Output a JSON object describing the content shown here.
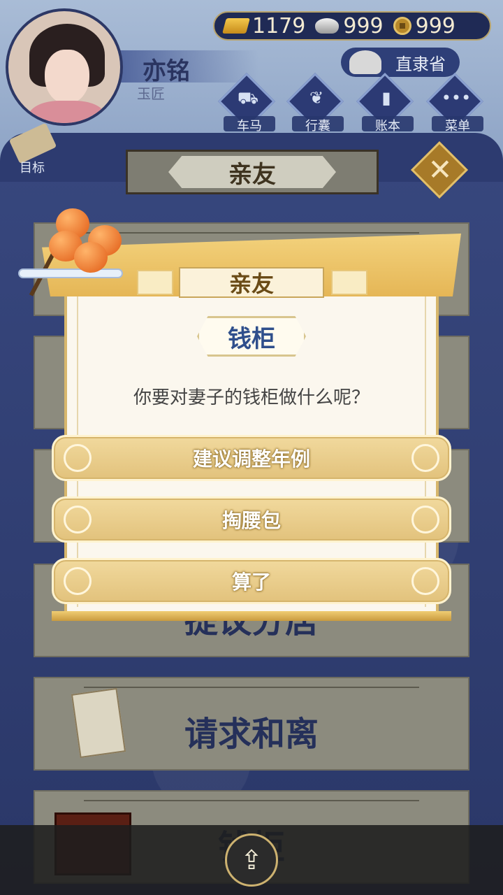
{
  "header": {
    "currencies": [
      {
        "icon": "gold-ingot-icon",
        "value": "1179"
      },
      {
        "icon": "silver-ingot-icon",
        "value": "999"
      },
      {
        "icon": "copper-coin-icon",
        "value": "999"
      }
    ],
    "player": {
      "name": "亦铭",
      "title": "玉匠"
    },
    "region": "直隶省"
  },
  "menu": [
    {
      "label": "车马",
      "icon": "carriage-icon"
    },
    {
      "label": "行囊",
      "icon": "bag-icon"
    },
    {
      "label": "账本",
      "icon": "ledger-icon"
    },
    {
      "label": "菜单",
      "icon": "more-icon"
    }
  ],
  "goal_label": "目标",
  "page_title": "亲友",
  "list_items": [
    {
      "label": ""
    },
    {
      "label": ""
    },
    {
      "label": ""
    },
    {
      "label": "提议分居"
    },
    {
      "label": "请求和离"
    },
    {
      "label": "钱柜"
    }
  ],
  "dialog": {
    "title": "亲友",
    "subtitle": "钱柜",
    "question": "你要对妻子的钱柜做什么呢？",
    "options": [
      "建议调整年例",
      "掏腰包",
      "算了"
    ]
  },
  "colors": {
    "accent_gold": "#e5b656",
    "panel_navy": "#2c3a6e",
    "option_text": "#ffffff"
  }
}
